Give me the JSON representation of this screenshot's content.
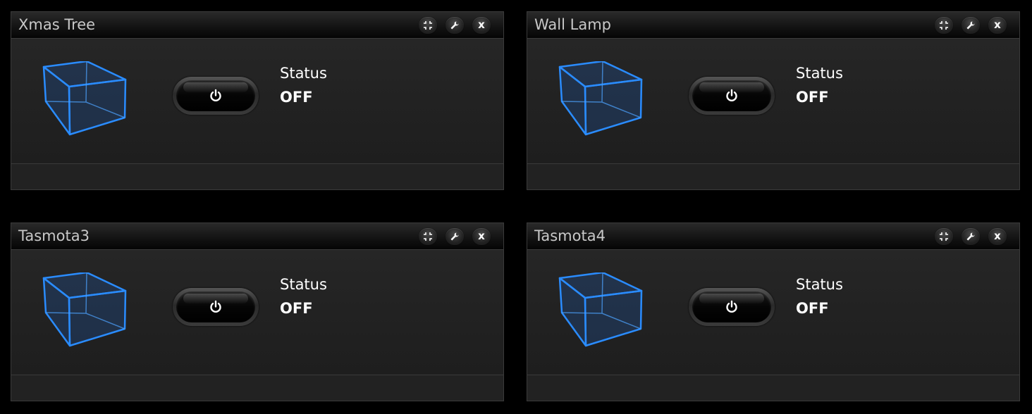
{
  "colors": {
    "background": "#000000",
    "accent_cube": "#2a8cff",
    "text": "#ffffff",
    "title_text": "#c8c8c8"
  },
  "widgets": [
    {
      "title": "Xmas Tree",
      "icon": "cube-icon",
      "status_label": "Status",
      "status_value": "OFF",
      "controls": [
        "expand-icon",
        "wrench-icon",
        "close-icon"
      ],
      "close_glyph": "x"
    },
    {
      "title": "Wall Lamp",
      "icon": "cube-icon",
      "status_label": "Status",
      "status_value": "OFF",
      "controls": [
        "expand-icon",
        "wrench-icon",
        "close-icon"
      ],
      "close_glyph": "x"
    },
    {
      "title": "Tasmota3",
      "icon": "cube-icon",
      "status_label": "Status",
      "status_value": "OFF",
      "controls": [
        "expand-icon",
        "wrench-icon",
        "close-icon"
      ],
      "close_glyph": "x"
    },
    {
      "title": "Tasmota4",
      "icon": "cube-icon",
      "status_label": "Status",
      "status_value": "OFF",
      "controls": [
        "expand-icon",
        "wrench-icon",
        "close-icon"
      ],
      "close_glyph": "x"
    }
  ]
}
